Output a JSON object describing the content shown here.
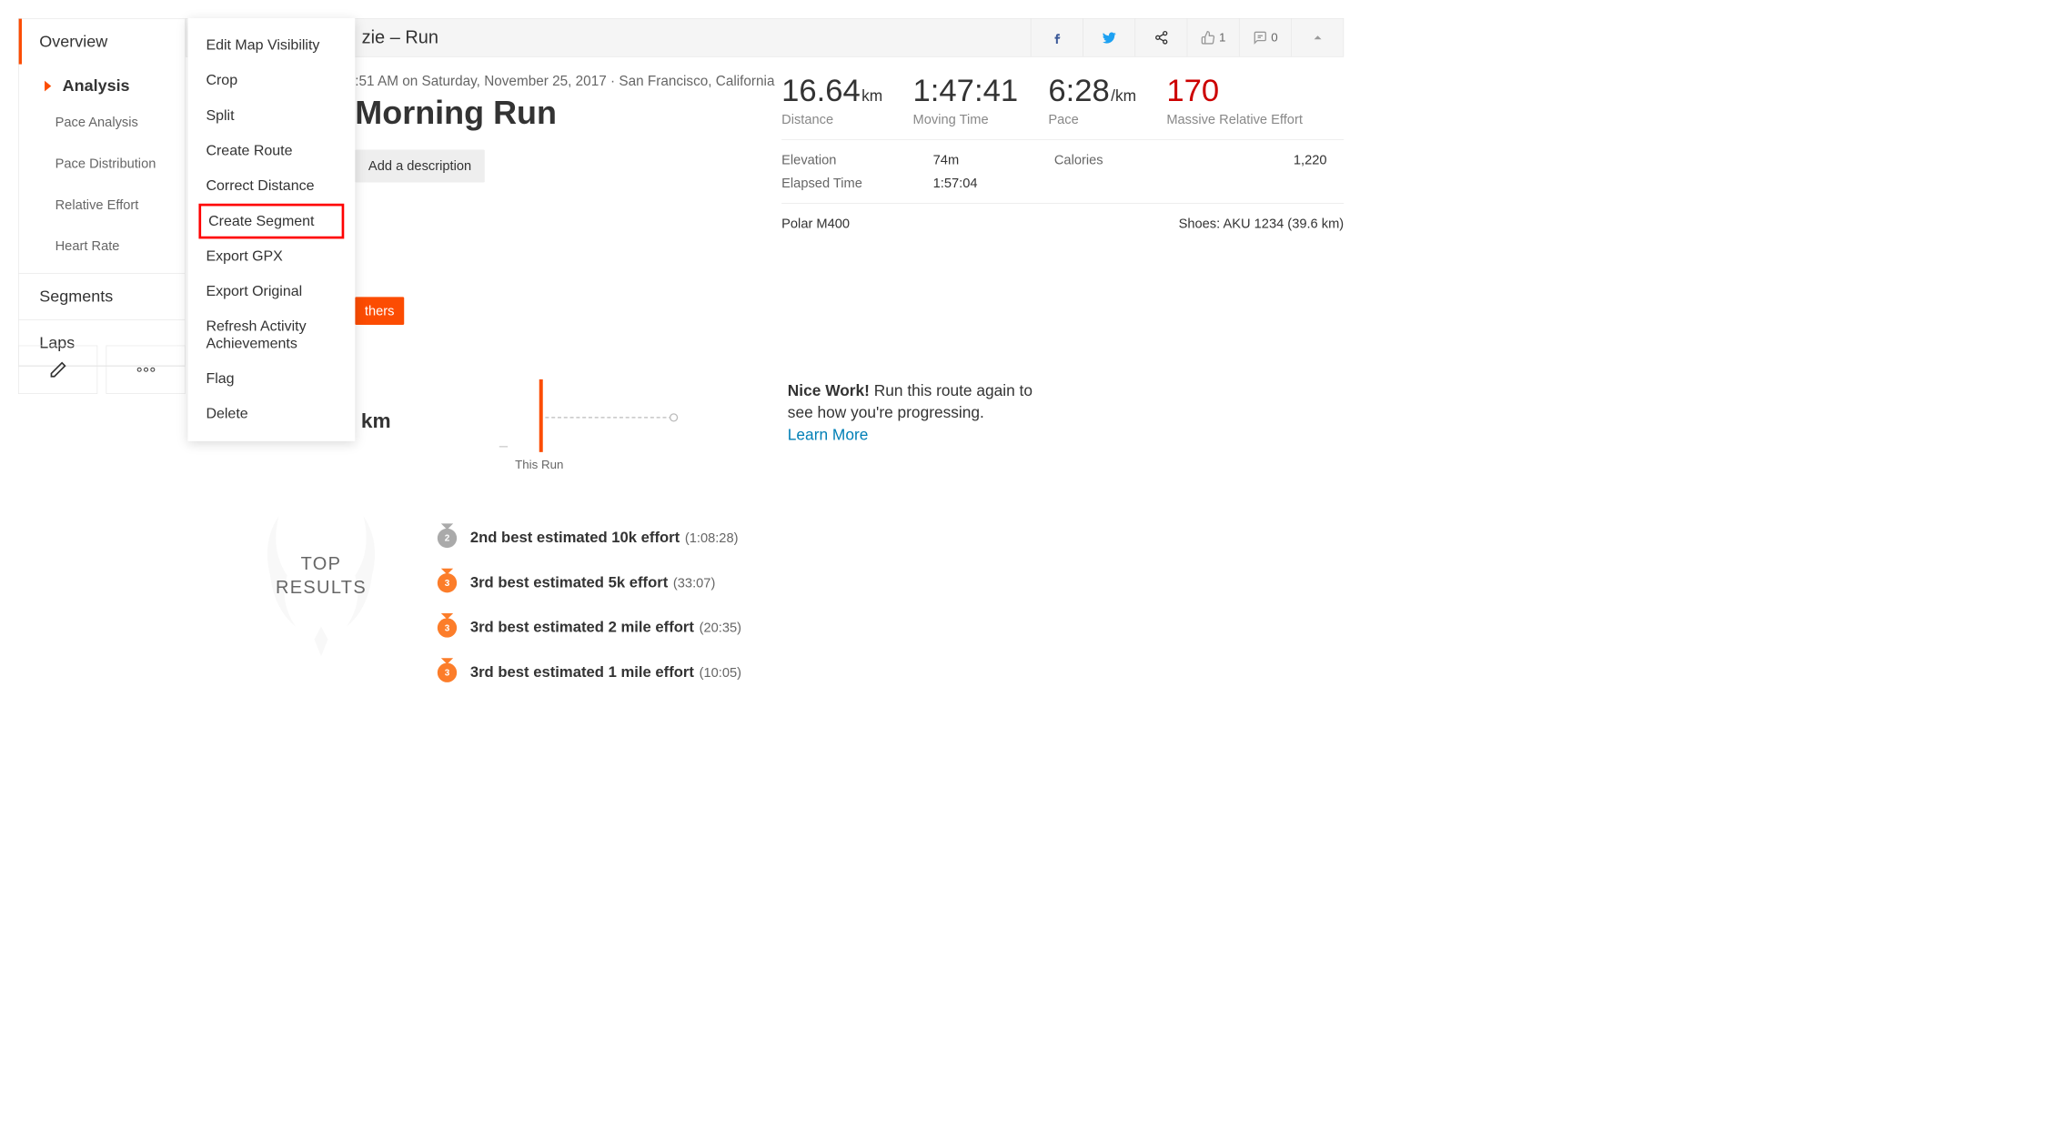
{
  "sidebar": {
    "overview": "Overview",
    "analysis": "Analysis",
    "subs": [
      "Pace Analysis",
      "Pace Distribution",
      "Relative Effort",
      "Heart Rate"
    ],
    "segments": "Segments",
    "laps": "Laps"
  },
  "menu": [
    "Edit Map Visibility",
    "Crop",
    "Split",
    "Create Route",
    "Correct Distance",
    "Create Segment",
    "Export GPX",
    "Export Original",
    "Refresh Activity Achievements",
    "Flag",
    "Delete"
  ],
  "menu_highlight_index": 5,
  "header": {
    "title_fragment": "zie – Run",
    "kudos": "1",
    "comments": "0"
  },
  "activity": {
    "meta": ":51 AM on Saturday, November 25, 2017 · San Francisco, California",
    "title": "Morning Run",
    "add_desc": "Add a description"
  },
  "stats": {
    "distance": {
      "val": "16.64",
      "unit": "km",
      "label": "Distance"
    },
    "moving": {
      "val": "1:47:41",
      "label": "Moving Time"
    },
    "pace": {
      "val": "6:28",
      "unit": "/km",
      "label": "Pace"
    },
    "effort": {
      "val": "170",
      "label": "Massive Relative Effort"
    },
    "elevation": {
      "label": "Elevation",
      "val": "74m"
    },
    "elapsed": {
      "label": "Elapsed Time",
      "val": "1:57:04"
    },
    "calories": {
      "label": "Calories",
      "val": "1,220"
    },
    "device": "Polar M400",
    "shoes": "Shoes: AKU 1234 (39.6 km)"
  },
  "orange_tag": "thers",
  "km_fragment": "km",
  "chart_label": "This Run",
  "nice_work": {
    "bold": "Nice Work!",
    "text": " Run this route again to see how you're progressing.",
    "link": "Learn More"
  },
  "top_results": {
    "heading_l1": "TOP",
    "heading_l2": "RESULTS",
    "items": [
      {
        "rank": "2",
        "medal": "silver",
        "text": "2nd best estimated 10k effort",
        "time": "(1:08:28)"
      },
      {
        "rank": "3",
        "medal": "bronze",
        "text": "3rd best estimated 5k effort",
        "time": "(33:07)"
      },
      {
        "rank": "3",
        "medal": "bronze",
        "text": "3rd best estimated 2 mile effort",
        "time": "(20:35)"
      },
      {
        "rank": "3",
        "medal": "bronze",
        "text": "3rd best estimated 1 mile effort",
        "time": "(10:05)"
      }
    ]
  }
}
